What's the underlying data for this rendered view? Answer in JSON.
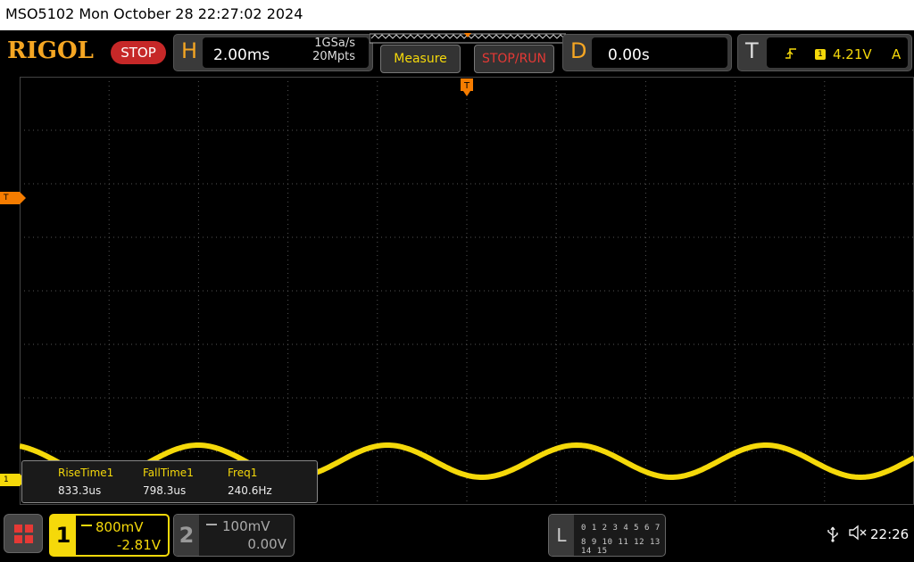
{
  "title_bar": {
    "text": "MSO5102  Mon October 28 22:27:02 2024"
  },
  "toolbar": {
    "logo": "RIGOL",
    "run_state": "STOP",
    "horizontal": {
      "letter": "H",
      "timebase": "2.00ms",
      "sample_rate": "1GSa/s",
      "memory_depth": "20Mpts"
    },
    "measure_label": "Measure",
    "stop_run_label": "STOP/RUN",
    "delay": {
      "letter": "D",
      "value": "0.00s"
    },
    "trigger": {
      "letter": "T",
      "source": "1",
      "level": "4.21V",
      "mode": "A",
      "edge_icon": "rising-edge-icon"
    }
  },
  "screen": {
    "trigger_marker_label": "T",
    "ch1_marker_label": "1",
    "top_trigger_marker_label": "T"
  },
  "measurements": [
    {
      "name": "RiseTime1",
      "value": "833.3us"
    },
    {
      "name": "FallTime1",
      "value": "798.3us"
    },
    {
      "name": "Freq1",
      "value": "240.6Hz"
    }
  ],
  "channels": {
    "ch1": {
      "number": "1",
      "scale": "800mV",
      "offset": "-2.81V",
      "color": "#f5d90a",
      "coupling_icon": "dc-coupling-icon"
    },
    "ch2": {
      "number": "2",
      "scale": "100mV",
      "offset": "0.00V",
      "color": "#aaaaaa",
      "coupling_icon": "dc-coupling-icon"
    }
  },
  "logic_analyzer": {
    "letter": "L",
    "row1": "0 1 2 3  4 5 6 7",
    "row2": "8 9 10 11 12 13 14 15"
  },
  "status": {
    "clock": "22:26",
    "usb_icon": "usb-icon",
    "sound_icon": "speaker-muted-icon"
  },
  "colors": {
    "accent": "#f5a623",
    "trace_ch1": "#f5d90a",
    "stop": "#c62828"
  }
}
